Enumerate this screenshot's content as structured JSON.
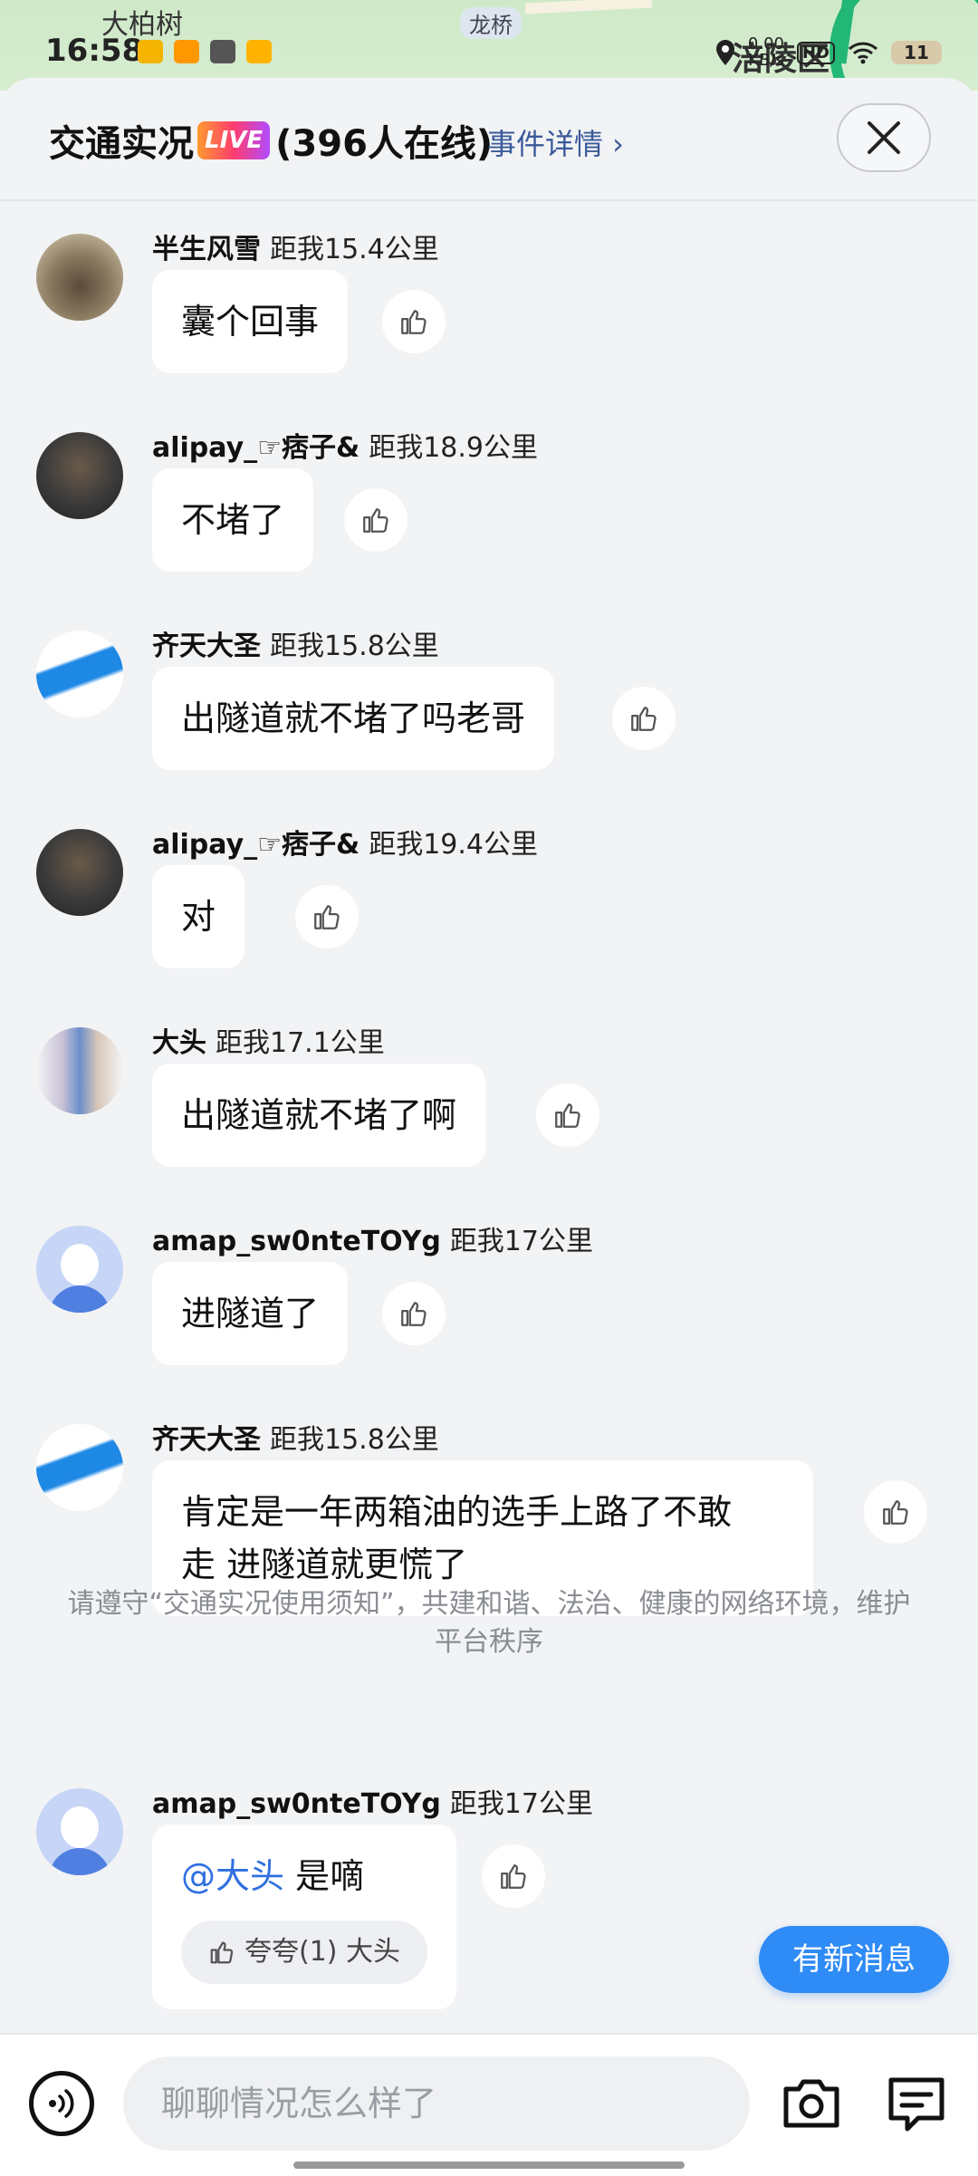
{
  "status_bar": {
    "time": "16:58",
    "net_speed": "0.00",
    "net_unit": "KB/s",
    "hd": "HD",
    "battery": "11"
  },
  "map": {
    "labels": [
      "大柏树",
      "龙桥",
      "涪陵区"
    ]
  },
  "header": {
    "title": "交通实况",
    "live_badge": "LIVE",
    "online": "(396人在线)",
    "event_link": "事件详情 ›"
  },
  "messages": [
    {
      "user": "半生风雪",
      "distance": "距我15.4公里",
      "text": "囊个回事"
    },
    {
      "user": "alipay_☞痞子&",
      "distance": "距我18.9公里",
      "text": "不堵了"
    },
    {
      "user": "齐天大圣",
      "distance": "距我15.8公里",
      "text": "出隧道就不堵了吗老哥"
    },
    {
      "user": "alipay_☞痞子&",
      "distance": "距我19.4公里",
      "text": "对"
    },
    {
      "user": "大头",
      "distance": "距我17.1公里",
      "text": "出隧道就不堵了啊"
    },
    {
      "user": "amap_sw0nteTOYg",
      "distance": "距我17公里",
      "text": "进隧道了"
    },
    {
      "user": "齐天大圣",
      "distance": "距我15.8公里",
      "text_line1": "肯定是一年两箱油的选手上路了不敢",
      "text_line2": "走 进隧道就更慌了"
    },
    {
      "user": "amap_sw0nteTOYg",
      "distance": "距我17公里",
      "mention": "@大头",
      "text": " 是嘀",
      "praise": "夸夸(1) 大头"
    }
  ],
  "notice": {
    "line1": "请遵守“交通实况使用须知”，共建和谐、法治、健康的网络环境，维护",
    "line2": "平台秩序"
  },
  "new_message_button": "有新消息",
  "composer": {
    "placeholder": "聊聊情况怎么样了"
  },
  "colors": {
    "accent": "#2f8bf5",
    "link": "#3a5a9a",
    "mention": "#2f6fe0",
    "background": "#f2f3f5"
  }
}
